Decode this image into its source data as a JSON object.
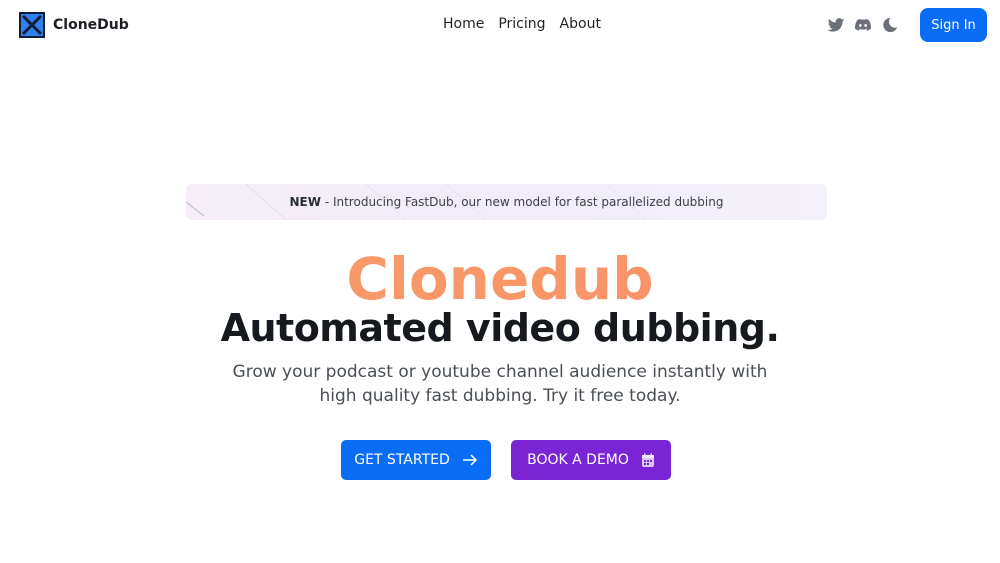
{
  "brand": {
    "name": "CloneDub"
  },
  "nav": {
    "links": [
      "Home",
      "Pricing",
      "About"
    ],
    "icons": [
      "twitter-icon",
      "discord-icon",
      "moon-icon"
    ],
    "signin_label": "Sign In"
  },
  "banner": {
    "tag": "NEW",
    "text": " - Introducing FastDub, our new model for fast parallelized dubbing"
  },
  "hero": {
    "brand_title": "Clonedub",
    "headline": "Automated video dubbing.",
    "subtitle": "Grow your podcast or youtube channel audience instantly with high quality fast dubbing. Try it free today.",
    "primary_cta": "GET STARTED",
    "secondary_cta": "BOOK A DEMO"
  },
  "colors": {
    "primary": "#0b6cf5",
    "demo": "#7a24d6",
    "brand_gradient_start": "#f6a06b",
    "brand_gradient_end": "#fb8d66"
  }
}
